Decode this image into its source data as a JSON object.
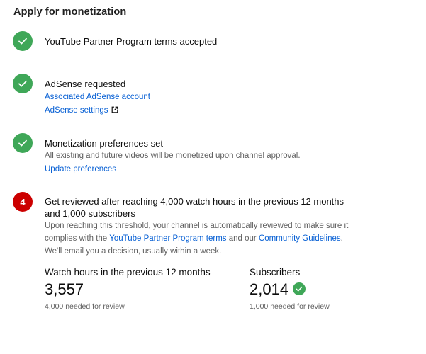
{
  "page": {
    "title": "Apply for monetization"
  },
  "steps": {
    "terms": {
      "title": "YouTube Partner Program terms accepted"
    },
    "adsense": {
      "title": "AdSense requested",
      "link_account": "Associated AdSense account",
      "link_settings": "AdSense settings"
    },
    "preferences": {
      "title": "Monetization preferences set",
      "description": "All existing and future videos will be monetized upon channel approval.",
      "link_update": "Update preferences"
    },
    "review": {
      "number": "4",
      "title": "Get reviewed after reaching 4,000 watch hours in the previous 12 months and 1,000 subscribers",
      "desc_part1": "Upon reaching this threshold, your channel is automatically reviewed to make sure it complies with the ",
      "link_terms": "YouTube Partner Program terms",
      "desc_part2": " and our ",
      "link_guidelines": "Community Guidelines",
      "desc_part3": ". We'll email you a decision, usually within a week."
    }
  },
  "stats": {
    "watch_hours": {
      "label": "Watch hours in the previous 12 months",
      "value": "3,557",
      "note": "4,000 needed for review"
    },
    "subscribers": {
      "label": "Subscribers",
      "value": "2,014",
      "note": "1,000 needed for review"
    }
  },
  "colors": {
    "done_green": "#3fa758",
    "pending_red": "#cc0000",
    "link_blue": "#065fd4",
    "secondary_text": "#606060"
  }
}
